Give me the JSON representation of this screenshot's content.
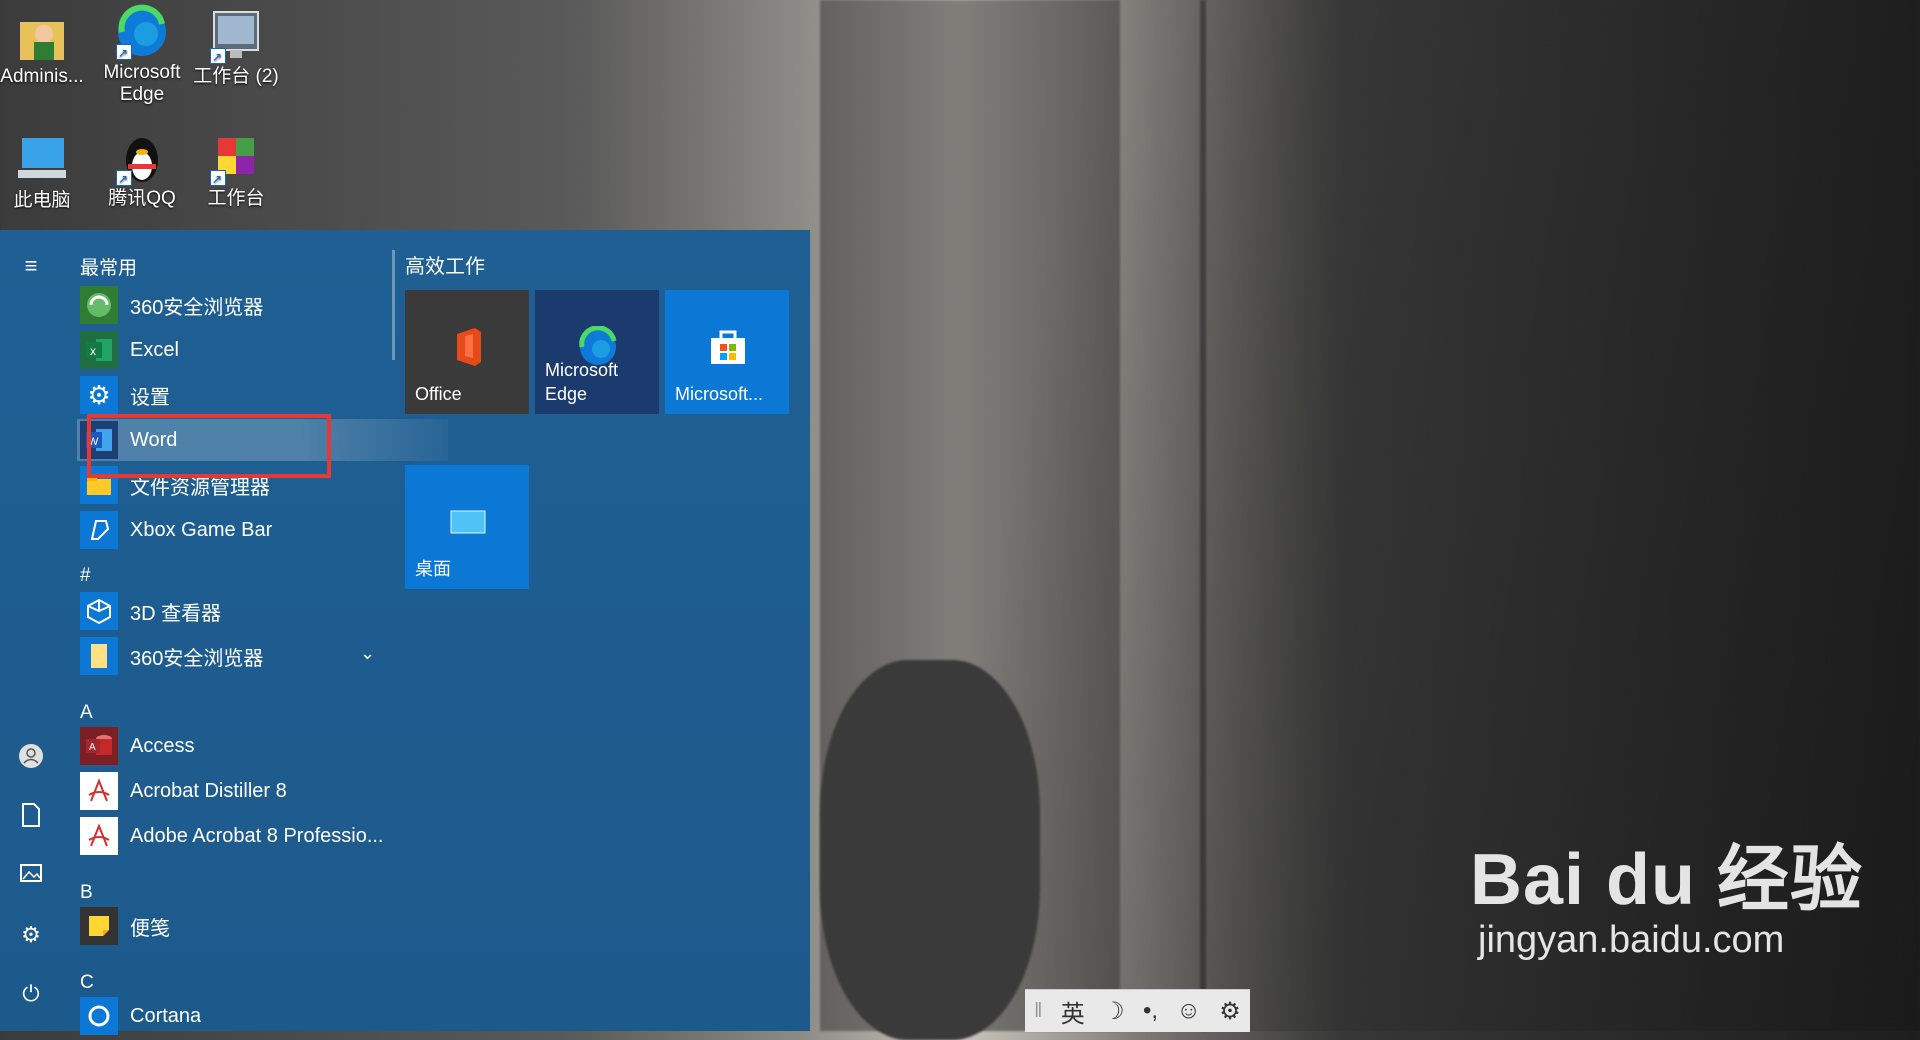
{
  "desktop": {
    "icons": [
      {
        "label": "Adminis..."
      },
      {
        "label": "Microsoft Edge"
      },
      {
        "label": "工作台 (2)"
      },
      {
        "label": "此电脑"
      },
      {
        "label": "腾讯QQ"
      },
      {
        "label": "工作台"
      }
    ]
  },
  "start_menu": {
    "most_used_header": "最常用",
    "most_used": [
      {
        "label": "360安全浏览器",
        "icon": "360-browser-icon"
      },
      {
        "label": "Excel",
        "icon": "excel-icon"
      },
      {
        "label": "设置",
        "icon": "gear-icon"
      },
      {
        "label": "Word",
        "icon": "word-icon"
      },
      {
        "label": "文件资源管理器",
        "icon": "file-explorer-icon"
      },
      {
        "label": "Xbox Game Bar",
        "icon": "xbox-game-bar-icon"
      }
    ],
    "sections": [
      {
        "header": "#",
        "items": [
          {
            "label": "3D 查看器",
            "icon": "3d-viewer-icon"
          },
          {
            "label": "360安全浏览器",
            "icon": "folder-icon",
            "expandable": true
          }
        ]
      },
      {
        "header": "A",
        "items": [
          {
            "label": "Access",
            "icon": "access-icon"
          },
          {
            "label": "Acrobat Distiller 8",
            "icon": "acrobat-icon"
          },
          {
            "label": "Adobe Acrobat 8 Professio...",
            "icon": "acrobat-icon"
          }
        ]
      },
      {
        "header": "B",
        "items": [
          {
            "label": "便笺",
            "icon": "sticky-notes-icon"
          }
        ]
      },
      {
        "header": "C",
        "items": [
          {
            "label": "Cortana",
            "icon": "cortana-icon"
          }
        ]
      }
    ],
    "rail": [
      "hamburger-menu-icon",
      "user-icon",
      "document-icon",
      "pictures-icon",
      "gear-icon",
      "power-icon"
    ],
    "tile_group": {
      "title": "高效工作",
      "tiles": [
        {
          "label": "Office",
          "icon": "office-icon",
          "color": "#3a3a3a"
        },
        {
          "label": "Microsoft Edge",
          "icon": "edge-icon",
          "color": "#1b3b6f"
        },
        {
          "label": "Microsoft...",
          "icon": "store-icon",
          "color": "#0a78d4"
        },
        {
          "label": "桌面",
          "icon": "desktop-icon",
          "color": "#0a78d4"
        }
      ]
    }
  },
  "ime_bar": {
    "language": "英",
    "items": [
      "moon-icon",
      "punctuation-icon",
      "emoji-icon",
      "gear-icon"
    ]
  },
  "watermark": {
    "brand": "Bai du 经验",
    "url": "jingyan.baidu.com"
  },
  "colors": {
    "start_bg": "#1f5f93",
    "highlight_box": "#e53935",
    "tile_blue": "#0a78d4"
  }
}
